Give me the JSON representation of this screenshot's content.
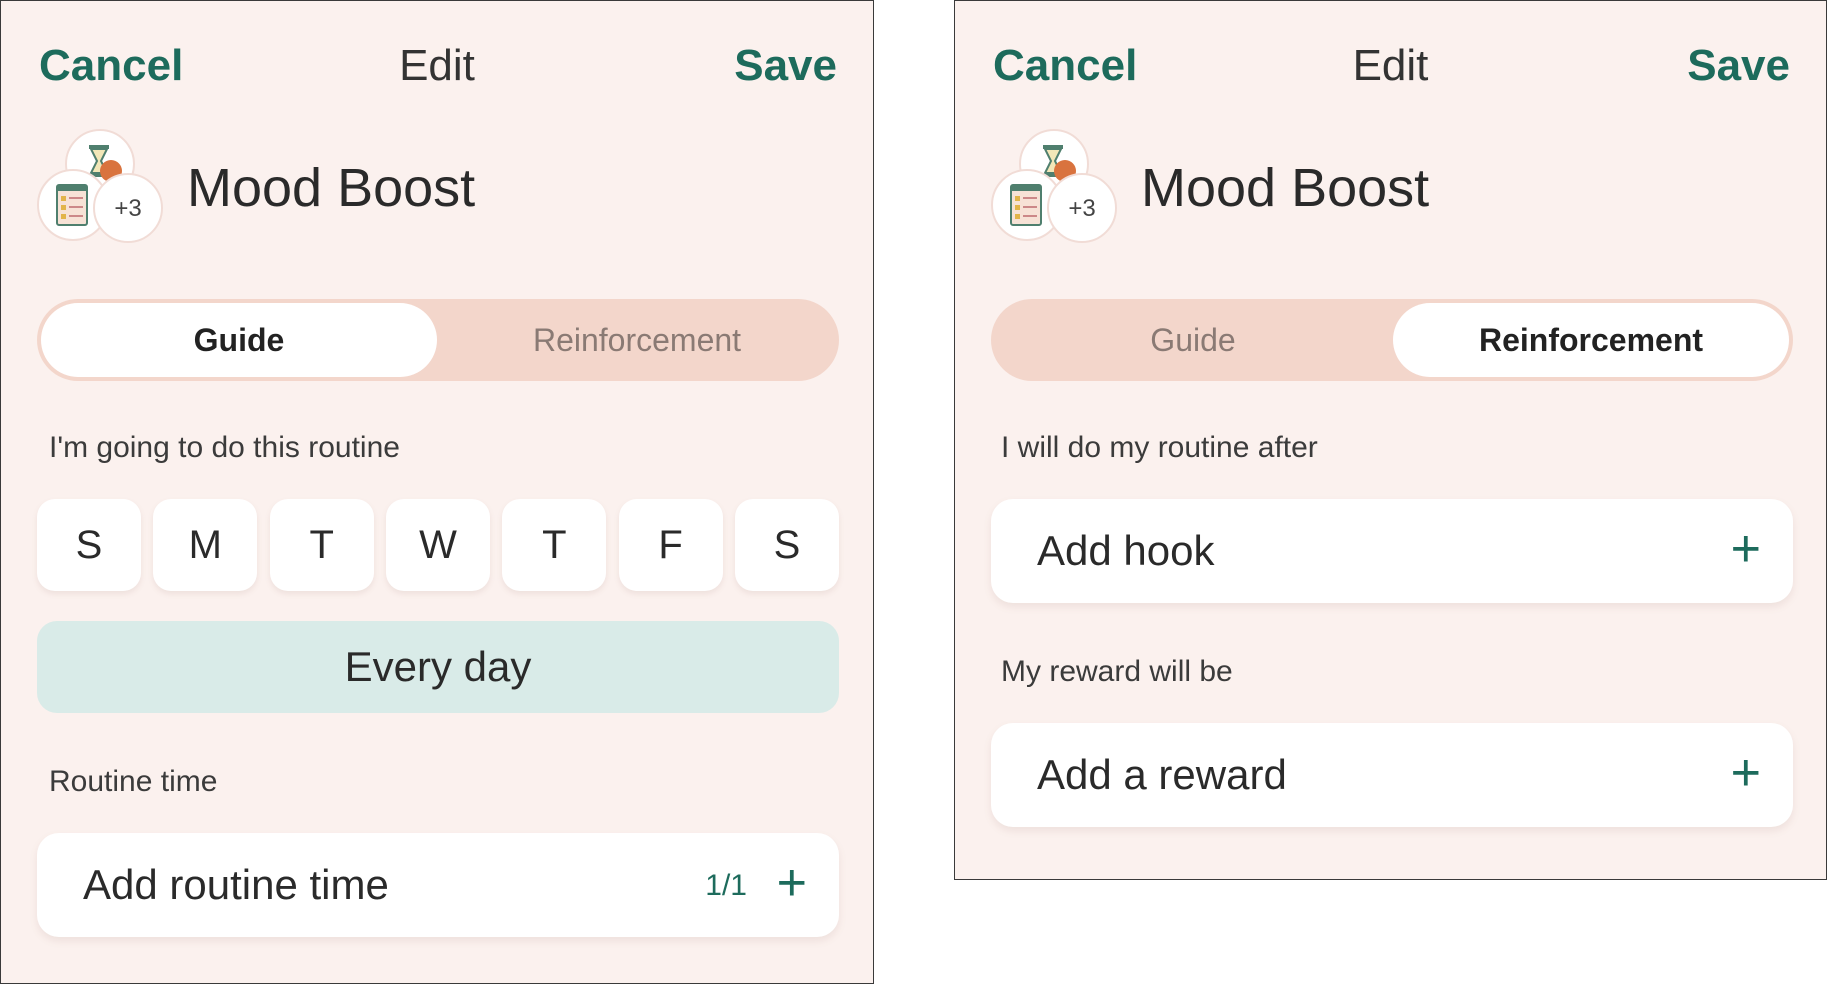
{
  "colors": {
    "accent": "#1d6b5c",
    "background": "#fbf1ee",
    "segment_bg": "#f3d6cb",
    "every_day_bg": "#d9ebe8"
  },
  "left": {
    "header": {
      "cancel": "Cancel",
      "title": "Edit",
      "save": "Save"
    },
    "routine": {
      "name": "Mood Boost",
      "extra_count": "+3",
      "icons": [
        "hourglass-icon",
        "checklist-icon"
      ]
    },
    "tabs": [
      {
        "label": "Guide",
        "active": true
      },
      {
        "label": "Reinforcement",
        "active": false
      }
    ],
    "schedule_label": "I'm going to do this routine",
    "days": [
      "S",
      "M",
      "T",
      "W",
      "T",
      "F",
      "S"
    ],
    "every_day": "Every day",
    "time_label": "Routine time",
    "time_card": {
      "label": "Add routine time",
      "count": "1/1",
      "icon": "plus-icon"
    }
  },
  "right": {
    "header": {
      "cancel": "Cancel",
      "title": "Edit",
      "save": "Save"
    },
    "routine": {
      "name": "Mood Boost",
      "extra_count": "+3",
      "icons": [
        "hourglass-icon",
        "checklist-icon"
      ]
    },
    "tabs": [
      {
        "label": "Guide",
        "active": false
      },
      {
        "label": "Reinforcement",
        "active": true
      }
    ],
    "hook_label": "I will do my routine after",
    "hook_card": {
      "label": "Add hook",
      "icon": "plus-icon"
    },
    "reward_label": "My reward will be",
    "reward_card": {
      "label": "Add a reward",
      "icon": "plus-icon"
    }
  }
}
